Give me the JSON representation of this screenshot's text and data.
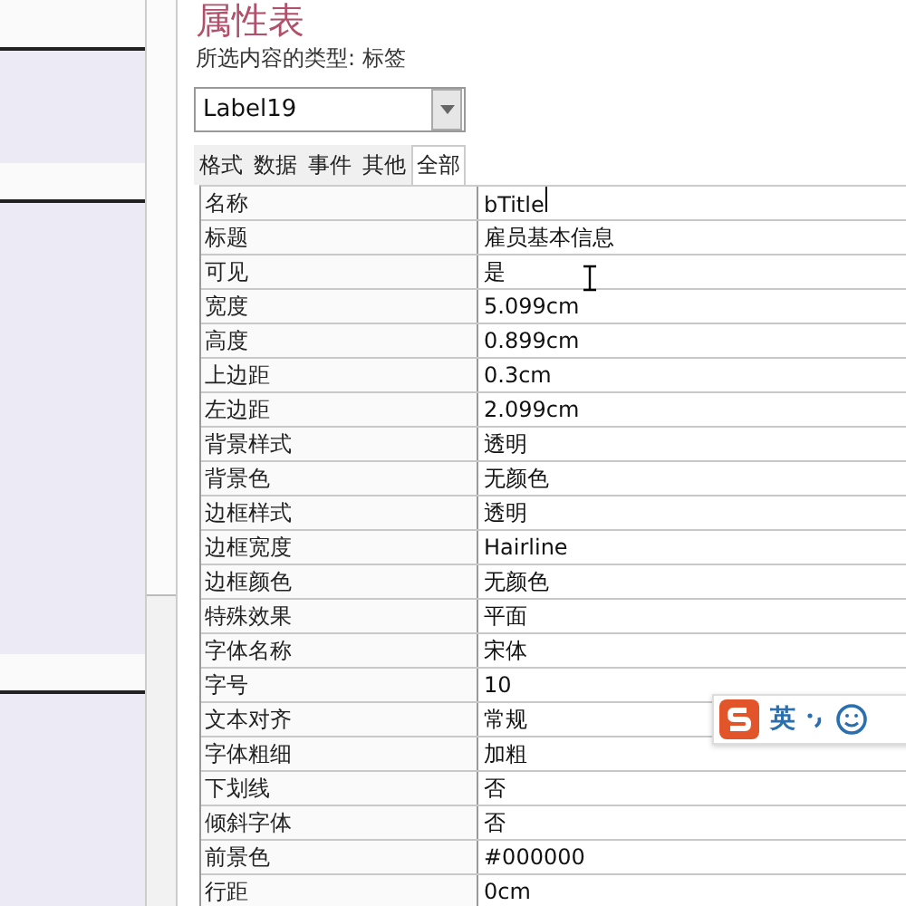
{
  "property_sheet": {
    "title": "属性表",
    "selection_type": "所选内容的类型: 标签",
    "object_select": {
      "value": "Label19"
    },
    "tabs": [
      {
        "label": "格式",
        "selected": false
      },
      {
        "label": "数据",
        "selected": false
      },
      {
        "label": "事件",
        "selected": false
      },
      {
        "label": "其他",
        "selected": false
      },
      {
        "label": "全部",
        "selected": true
      }
    ],
    "properties": [
      {
        "name": "名称",
        "value": "bTitle",
        "editing": true
      },
      {
        "name": "标题",
        "value": "雇员基本信息",
        "editing": false
      },
      {
        "name": "可见",
        "value": "是",
        "editing": false
      },
      {
        "name": "宽度",
        "value": "5.099cm",
        "editing": false
      },
      {
        "name": "高度",
        "value": "0.899cm",
        "editing": false
      },
      {
        "name": "上边距",
        "value": "0.3cm",
        "editing": false
      },
      {
        "name": "左边距",
        "value": "2.099cm",
        "editing": false
      },
      {
        "name": "背景样式",
        "value": "透明",
        "editing": false
      },
      {
        "name": "背景色",
        "value": "无颜色",
        "editing": false
      },
      {
        "name": "边框样式",
        "value": "透明",
        "editing": false
      },
      {
        "name": "边框宽度",
        "value": "Hairline",
        "editing": false
      },
      {
        "name": "边框颜色",
        "value": "无颜色",
        "editing": false
      },
      {
        "name": "特殊效果",
        "value": "平面",
        "editing": false
      },
      {
        "name": "字体名称",
        "value": "宋体",
        "editing": false
      },
      {
        "name": "字号",
        "value": "10",
        "editing": false
      },
      {
        "name": "文本对齐",
        "value": "常规",
        "editing": false
      },
      {
        "name": "字体粗细",
        "value": "加粗",
        "editing": false
      },
      {
        "name": "下划线",
        "value": "否",
        "editing": false
      },
      {
        "name": "倾斜字体",
        "value": "否",
        "editing": false
      },
      {
        "name": "前景色",
        "value": "#000000",
        "editing": false
      },
      {
        "name": "行距",
        "value": "0cm",
        "editing": false
      }
    ]
  },
  "ime_toolbar": {
    "language": "英"
  }
}
